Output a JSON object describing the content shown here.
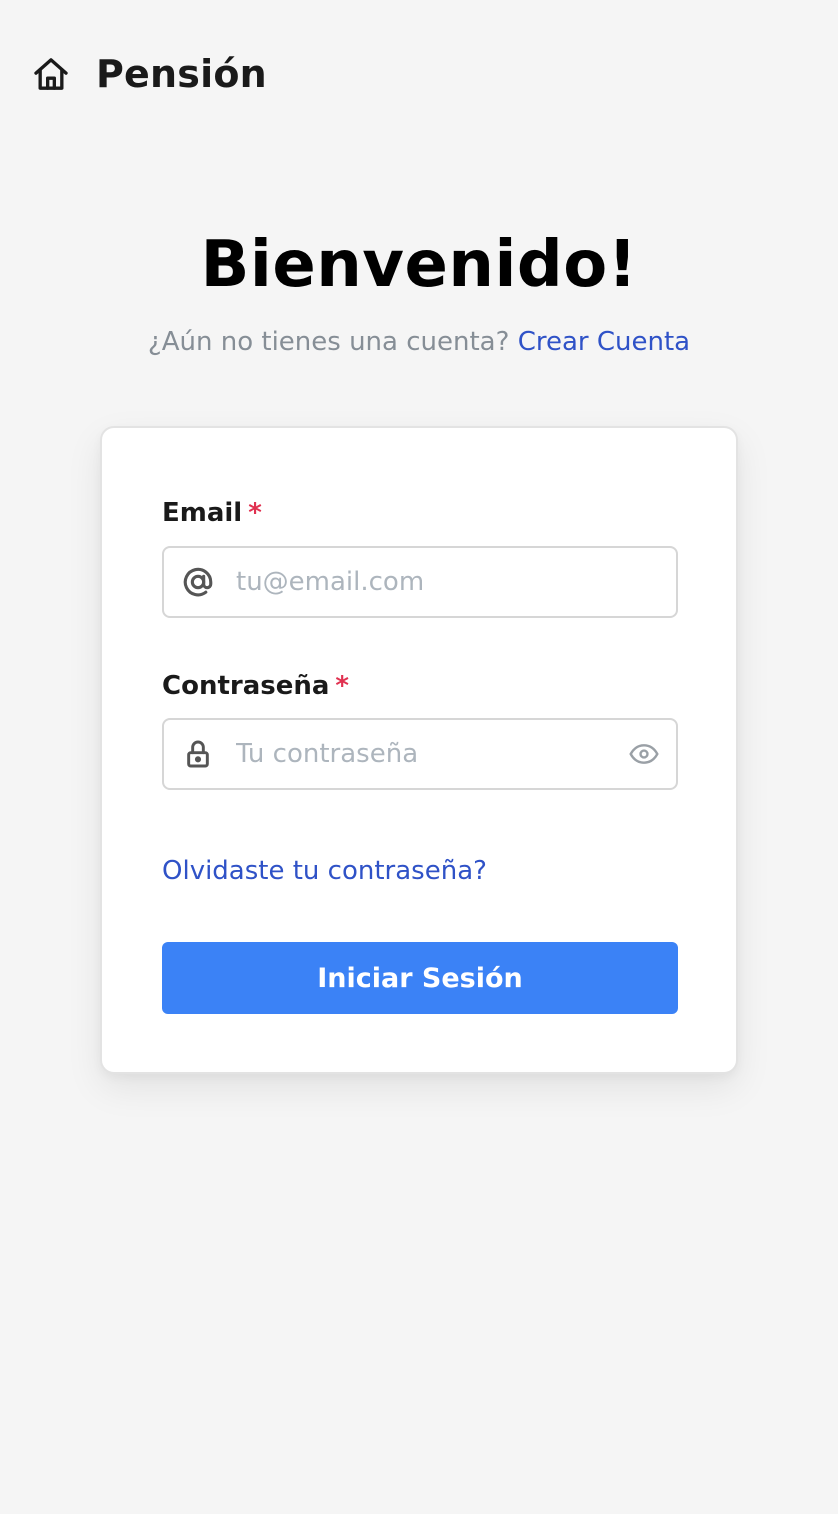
{
  "header": {
    "brand": "Pensión",
    "icon": "home-icon"
  },
  "hero": {
    "title": "Bienvenido!",
    "subtitle_text": "¿Aún no tienes una cuenta?",
    "create_account_link": "Crear Cuenta"
  },
  "form": {
    "email": {
      "label": "Email",
      "required_mark": "*",
      "placeholder": "tu@email.com",
      "value": "",
      "icon": "at-icon"
    },
    "password": {
      "label": "Contraseña",
      "required_mark": "*",
      "placeholder": "Tu contraseña",
      "value": "",
      "icon": "lock-icon",
      "toggle_icon": "eye-icon"
    },
    "forgot_password_link": "Olvidaste tu contraseña?",
    "submit_label": "Iniciar Sesión"
  },
  "colors": {
    "background": "#f5f5f5",
    "link": "#2f52c7",
    "primary_button": "#3b82f6",
    "required": "#e03150",
    "muted_text": "#868e96",
    "placeholder": "#adb5bd"
  }
}
